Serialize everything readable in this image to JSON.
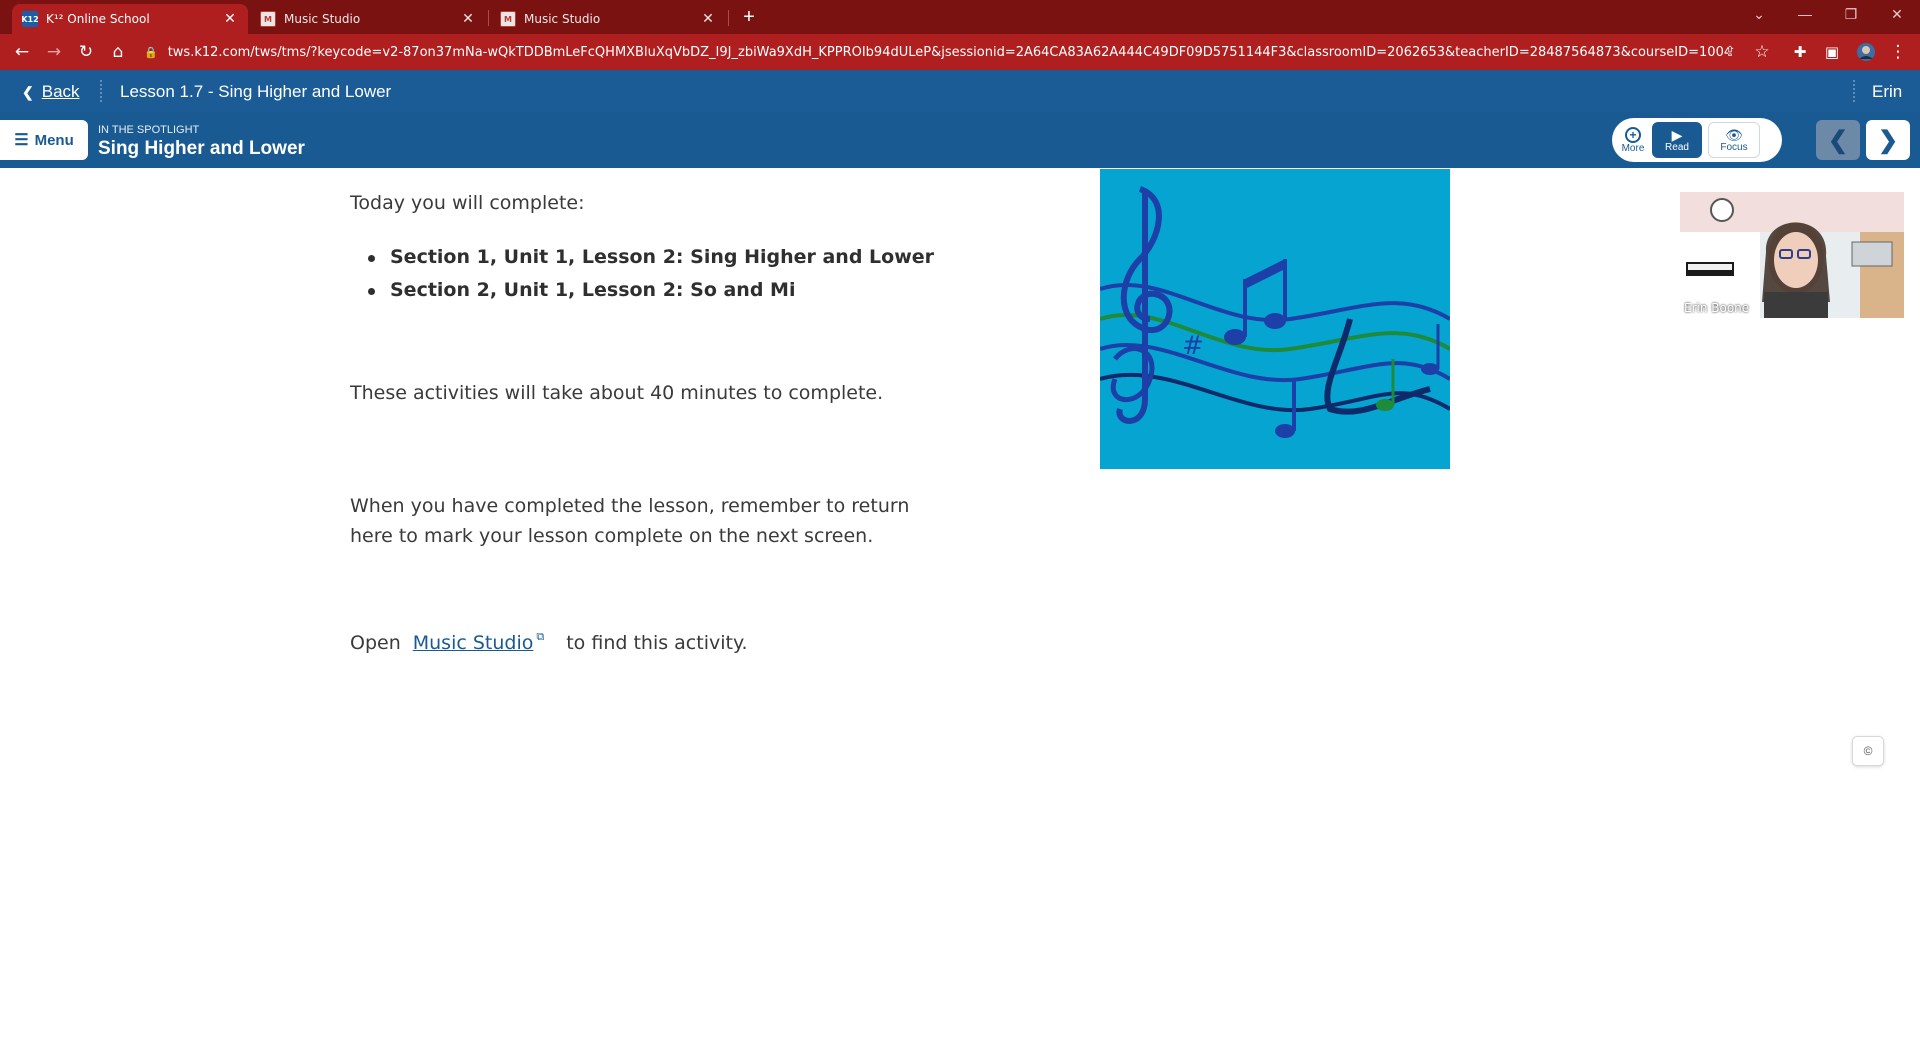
{
  "browser": {
    "tabs": [
      {
        "title": "K¹² Online School",
        "active": true,
        "favicon": "k12-favicon"
      },
      {
        "title": "Music Studio",
        "active": false,
        "favicon": "music-studio-favicon"
      },
      {
        "title": "Music Studio",
        "active": false,
        "favicon": "music-studio-favicon"
      }
    ],
    "url": "tws.k12.com/tws/tms/?keycode=v2-87on37mNa-wQkTDDBmLeFcQHMXBluXqVbDZ_I9J_zbiWa9XdH_KPPROIb94dULeP&jsessionid=2A64CA83A62A444C49DF09D5751144F3&classroomID=2062653&teacherID=28487564873&courseID=1004293&..."
  },
  "app_header": {
    "back_label": "Back",
    "lesson_title": "Lesson 1.7 - Sing Higher and Lower",
    "user_name": "Erin"
  },
  "sub_header": {
    "menu_label": "Menu",
    "section_label": "IN THE SPOTLIGHT",
    "section_title": "Sing Higher and Lower"
  },
  "tools": {
    "more_label": "More",
    "read_label": "Read",
    "focus_label": "Focus"
  },
  "content": {
    "intro": "Today you will complete:",
    "items": [
      "Section 1, Unit 1, Lesson 2: Sing Higher and Lower",
      "Section 2, Unit 1, Lesson 2: So and Mi"
    ],
    "duration": "These activities will take about 40 minutes to complete.",
    "reminder": "When you have completed the lesson, remember to return here to mark your lesson complete on the next screen.",
    "open_prefix": "Open",
    "open_link": "Music Studio",
    "open_suffix": "to find this activity."
  },
  "video": {
    "participant_name": "Erin Boone"
  },
  "copyright_symbol": "©",
  "colors": {
    "tabstrip": "#7a1212",
    "toolbar": "#b01f1f",
    "app_header": "#1b5c96",
    "accent": "#1a5a93",
    "music_bg": "#06a4d0"
  }
}
